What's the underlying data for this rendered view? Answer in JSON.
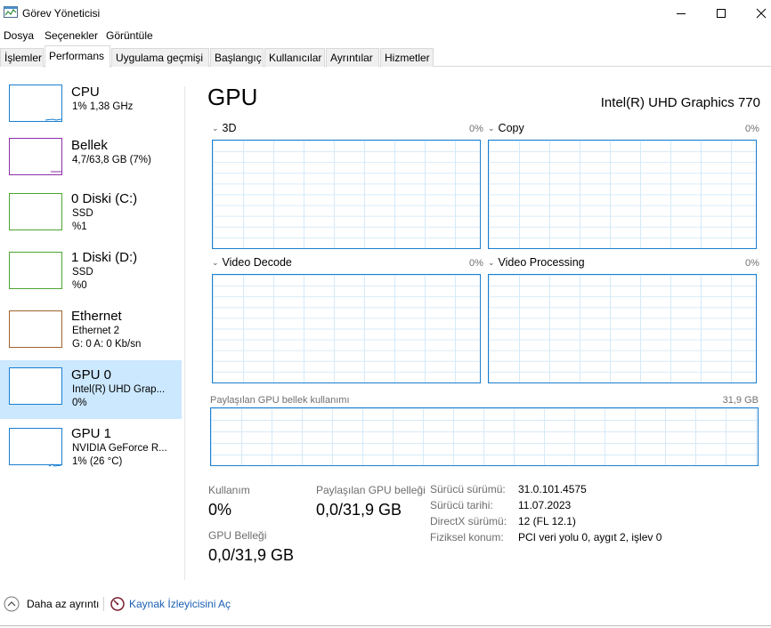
{
  "window": {
    "title": "Görev Yöneticisi"
  },
  "menu": [
    "Dosya",
    "Seçenekler",
    "Görüntüle"
  ],
  "tabs": [
    "İşlemler",
    "Performans",
    "Uygulama geçmişi",
    "Başlangıç",
    "Kullanıcılar",
    "Ayrıntılar",
    "Hizmetler"
  ],
  "active_tab": "Performans",
  "sidebar": [
    {
      "title": "CPU",
      "line1": "1% 1,38 GHz",
      "line2": "",
      "color": "#1a7fd0"
    },
    {
      "title": "Bellek",
      "line1": "4,7/63,8 GB (7%)",
      "line2": "",
      "color": "#8b2fa8"
    },
    {
      "title": "0 Diski (C:)",
      "line1": "SSD",
      "line2": "%1",
      "color": "#4da332"
    },
    {
      "title": "1 Diski (D:)",
      "line1": "SSD",
      "line2": "%0",
      "color": "#4da332"
    },
    {
      "title": "Ethernet",
      "line1": "Ethernet 2",
      "line2": "G: 0  A: 0 Kb/sn",
      "color": "#a0622d"
    },
    {
      "title": "GPU 0",
      "line1": "Intel(R) UHD Grap...",
      "line2": "0%",
      "color": "#1a7fd0"
    },
    {
      "title": "GPU 1",
      "line1": "NVIDIA GeForce R...",
      "line2": "1% (26 °C)",
      "color": "#1a7fd0"
    }
  ],
  "main": {
    "title": "GPU",
    "gpu_name": "Intel(R) UHD Graphics 770",
    "graphs": [
      {
        "label": "3D",
        "pct": "0%"
      },
      {
        "label": "Copy",
        "pct": "0%"
      },
      {
        "label": "Video Decode",
        "pct": "0%"
      },
      {
        "label": "Video Processing",
        "pct": "0%"
      }
    ],
    "shared_memory_label": "Paylaşılan GPU bellek kullanımı",
    "shared_memory_max": "31,9 GB",
    "stats": {
      "usage_label": "Kullanım",
      "usage_value": "0%",
      "shared_label": "Paylaşılan GPU belleği",
      "shared_value": "0,0/31,9 GB",
      "gpu_mem_label": "GPU Belleği",
      "gpu_mem_value": "0,0/31,9 GB"
    },
    "info": [
      {
        "key": "Sürücü sürümü:",
        "value": "31.0.101.4575"
      },
      {
        "key": "Sürücü tarihi:",
        "value": "11.07.2023"
      },
      {
        "key": "DirectX sürümü:",
        "value": "12 (FL 12.1)"
      },
      {
        "key": "Fiziksel konum:",
        "value": "PCI veri yolu 0, aygıt 2, işlev 0"
      }
    ]
  },
  "footer": {
    "fewer_details": "Daha az ayrıntı",
    "resource_monitor": "Kaynak İzleyicisini Aç"
  }
}
